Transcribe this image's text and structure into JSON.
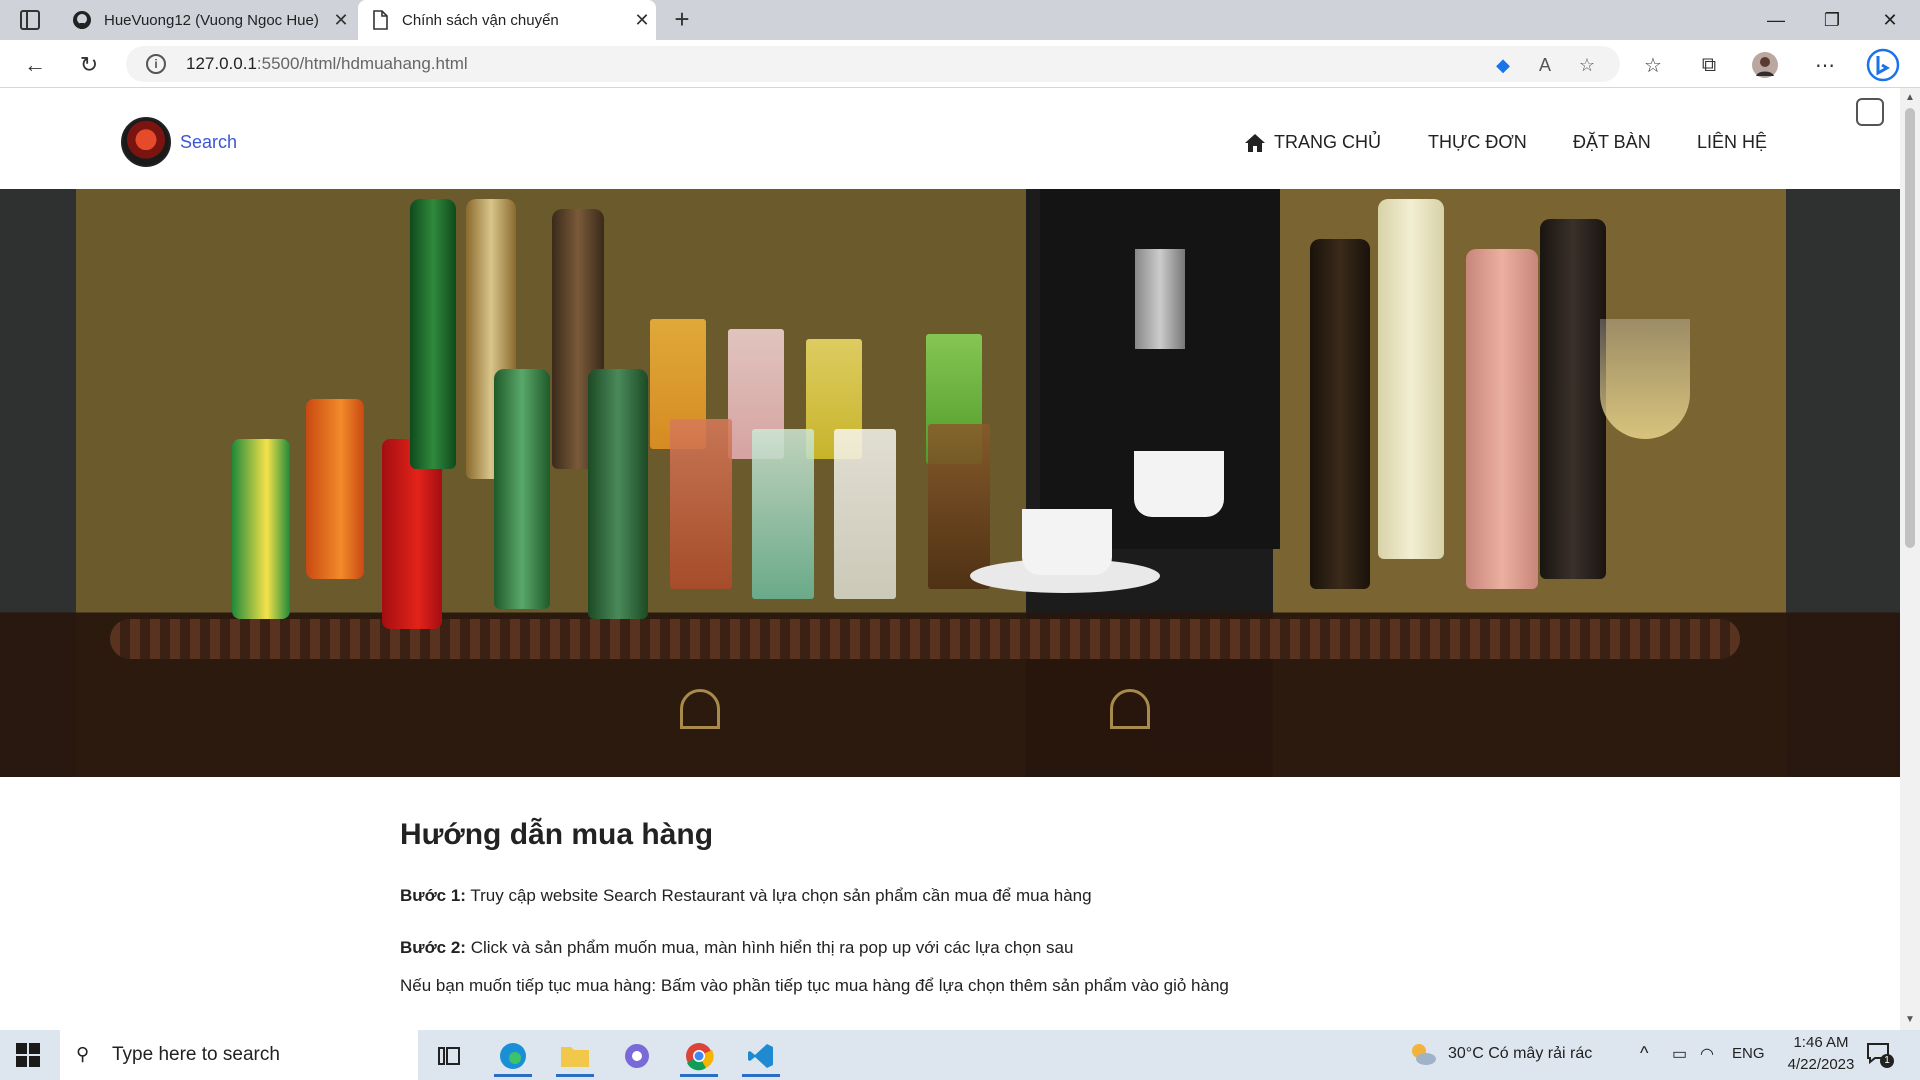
{
  "browser": {
    "tabs": [
      {
        "title": "HueVuong12 (Vuong Ngoc Hue)",
        "icon": "github-icon",
        "active": false
      },
      {
        "title": "Chính sách vận chuyển",
        "icon": "page-icon",
        "active": true
      }
    ],
    "url_host": "127.0.0.1",
    "url_rest": ":5500/html/hdmuahang.html"
  },
  "site": {
    "brand": "Search",
    "nav": {
      "home": "TRANG CHỦ",
      "menu": "THỰC ĐƠN",
      "booking": "ĐẶT BÀN",
      "contact": "LIÊN HỆ"
    }
  },
  "content": {
    "title": "Hướng dẫn mua hàng",
    "step1_label": "Bước 1:",
    "step1_text": " Truy cập website Search Restaurant và lựa chọn sản phẩm cần mua để mua hàng",
    "step2_label": "Bước 2:",
    "step2_text": " Click và sản phẩm muốn mua, màn hình hiển thị ra pop up với các lựa chọn sau",
    "step2_note": "Nếu bạn muốn tiếp tục mua hàng: Bấm vào phần tiếp tục mua hàng để lựa chọn thêm sản phẩm vào giỏ hàng"
  },
  "taskbar": {
    "search_placeholder": "Type here to search",
    "weather": "30°C  Có mây rải rác",
    "lang": "ENG",
    "time": "1:46 AM",
    "date": "4/22/2023",
    "notification_count": "1"
  },
  "colors": {
    "brand": "#3a56d4",
    "accent": "#2b6cc4"
  }
}
